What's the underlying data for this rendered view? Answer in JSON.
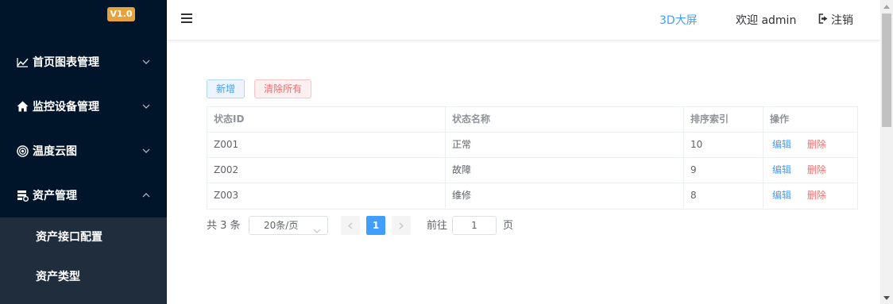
{
  "sidebar": {
    "version": "V1.0",
    "items": [
      {
        "label": "首页图表管理",
        "icon": "line-chart-icon",
        "expanded": false
      },
      {
        "label": "监控设备管理",
        "icon": "home-icon",
        "expanded": false
      },
      {
        "label": "温度云图",
        "icon": "target-icon",
        "expanded": false
      },
      {
        "label": "资产管理",
        "icon": "asset-settings-icon",
        "expanded": true
      }
    ],
    "submenu": [
      {
        "label": "资产接口配置"
      },
      {
        "label": "资产类型"
      }
    ]
  },
  "header": {
    "screen_link": "3D大屏",
    "welcome": "欢迎 admin",
    "logout": "注销"
  },
  "toolbar": {
    "add_label": "新增",
    "clear_label": "清除所有"
  },
  "table": {
    "columns": [
      "状态ID",
      "状态名称",
      "排序索引",
      "操作"
    ],
    "rows": [
      {
        "id": "Z001",
        "name": "正常",
        "index": "10",
        "edit": "编辑",
        "delete": "删除"
      },
      {
        "id": "Z002",
        "name": "故障",
        "index": "9",
        "edit": "编辑",
        "delete": "删除"
      },
      {
        "id": "Z003",
        "name": "维修",
        "index": "8",
        "edit": "编辑",
        "delete": "删除"
      }
    ]
  },
  "pagination": {
    "total": "共 3 条",
    "page_size": "20条/页",
    "current": "1",
    "goto_label": "前往",
    "goto_value": "1",
    "goto_suffix": "页"
  },
  "colors": {
    "sidebar_bg": "#001529",
    "submenu_bg": "#1f2d3d",
    "primary": "#409eff",
    "danger": "#f56c6c",
    "badge": "#e6a23c"
  }
}
